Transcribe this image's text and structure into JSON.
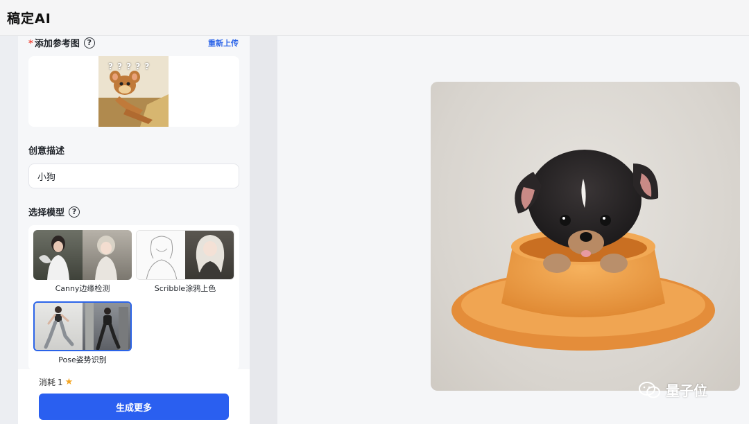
{
  "app": {
    "title": "稿定AI"
  },
  "reference": {
    "label": "添加参考图",
    "required_mark": "*",
    "reupload_label": "重新上传",
    "thumb_text": "? ? ? ? ?"
  },
  "description": {
    "label": "创意描述",
    "value": "小狗"
  },
  "model": {
    "label": "选择模型",
    "options": [
      {
        "name": "Canny边缘检测",
        "selected": false
      },
      {
        "name": "Scribble涂鸦上色",
        "selected": false
      },
      {
        "name": "Pose姿势识别",
        "selected": true
      }
    ]
  },
  "footer": {
    "cost_label": "消耗",
    "cost_value": "1",
    "generate_label": "生成更多"
  },
  "result": {
    "watermark": "量子位"
  },
  "colors": {
    "accent": "#2a5ff0",
    "required": "#f04b3e",
    "star": "#f5a623"
  }
}
